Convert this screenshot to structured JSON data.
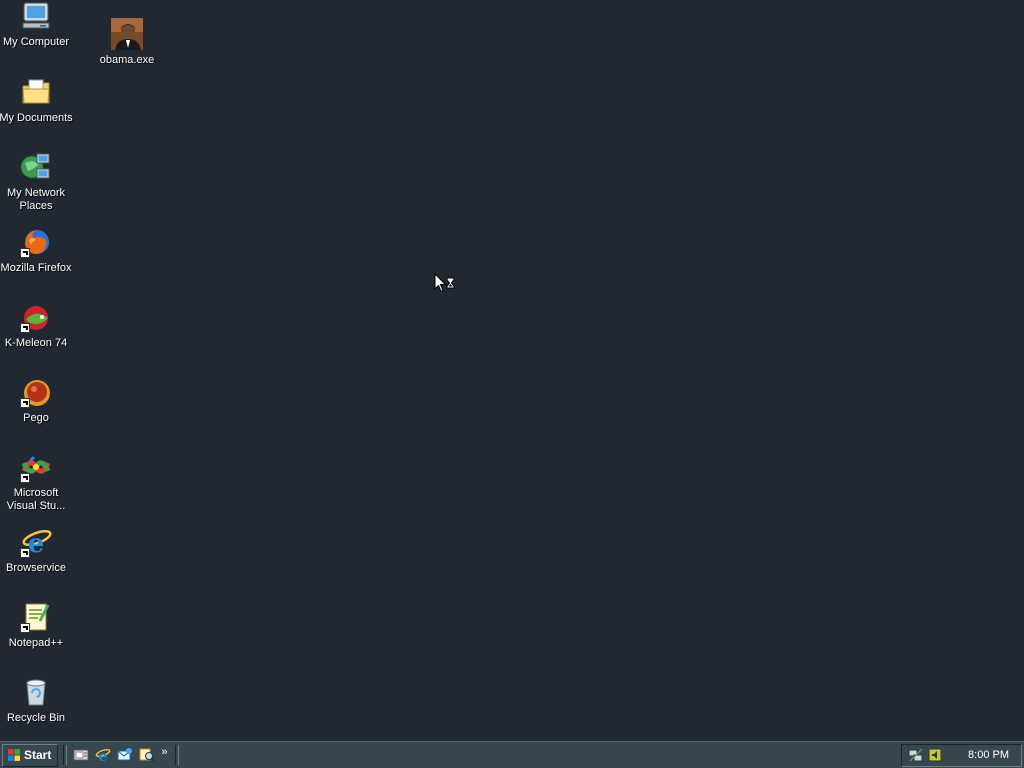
{
  "desktop": {
    "icons": [
      {
        "label": "My Computer",
        "icon": "my-computer-icon"
      },
      {
        "label": "My Documents",
        "icon": "my-documents-icon"
      },
      {
        "label": "My Network Places",
        "icon": "network-places-icon"
      },
      {
        "label": "Mozilla Firefox",
        "icon": "firefox-icon"
      },
      {
        "label": "K-Meleon 74",
        "icon": "k-meleon-icon"
      },
      {
        "label": "Pego",
        "icon": "pego-icon"
      },
      {
        "label": "Microsoft Visual Stu...",
        "icon": "visual-studio-icon"
      },
      {
        "label": "Browservice",
        "icon": "internet-explorer-icon"
      },
      {
        "label": "Notepad++",
        "icon": "notepad-plus-plus-icon"
      },
      {
        "label": "Recycle Bin",
        "icon": "recycle-bin-icon"
      },
      {
        "label": "obama.exe",
        "icon": "portrait-icon"
      }
    ],
    "background_color": "#222832"
  },
  "taskbar": {
    "start_label": "Start",
    "quick_launch": [
      "show-desktop-icon",
      "internet-explorer-icon",
      "outlook-express-icon",
      "search-icon"
    ],
    "overflow_label": "»",
    "tray_icons": [
      "network-status-icon",
      "volume-icon"
    ],
    "clock": "8:00 PM",
    "color": "#37474f"
  },
  "cursor": {
    "icon": "busy-cursor-icon"
  }
}
